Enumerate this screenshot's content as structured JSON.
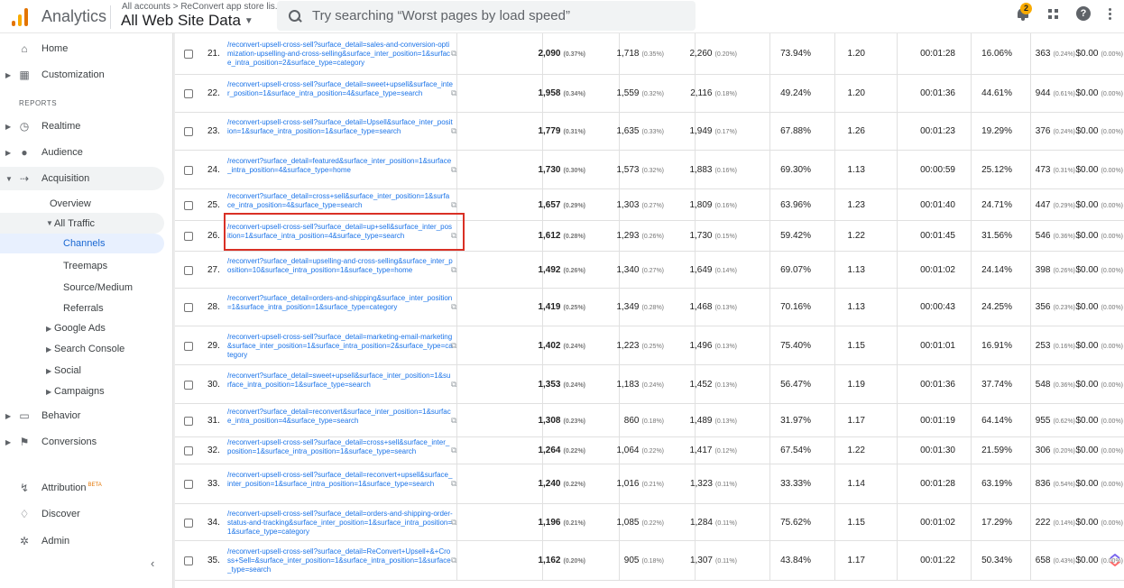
{
  "topbar": {
    "app_title": "Analytics",
    "breadcrumb": "All accounts > ReConvert app store lis...",
    "view_name": "All Web Site Data",
    "search_placeholder": "Try searching “Worst pages by load speed”",
    "notification_count": "2"
  },
  "sidebar": {
    "home": "Home",
    "customization": "Customization",
    "reports_header": "REPORTS",
    "realtime": "Realtime",
    "audience": "Audience",
    "acquisition": "Acquisition",
    "overview": "Overview",
    "all_traffic": "All Traffic",
    "channels": "Channels",
    "treemaps": "Treemaps",
    "source_medium": "Source/Medium",
    "referrals": "Referrals",
    "google_ads": "Google Ads",
    "search_console": "Search Console",
    "social": "Social",
    "campaigns": "Campaigns",
    "behavior": "Behavior",
    "conversions": "Conversions",
    "attribution": "Attribution",
    "attribution_badge": "BETA",
    "discover": "Discover",
    "admin": "Admin"
  },
  "table": {
    "highlighted_row": 26,
    "rows": [
      {
        "n": "21.",
        "page": "/reconvert-upsell-cross-sell?surface_detail=sales-and-conversion-optimization-upselling-and-cross-selling&surface_inter_position=1&surface_intra_position=2&surface_type=category",
        "pv": "2,090",
        "pvp": "(0.37%)",
        "upv": "1,718",
        "upvp": "(0.35%)",
        "ent": "2,260",
        "entp": "(0.20%)",
        "bounce": "73.94%",
        "pps": "1.20",
        "dur": "00:01:28",
        "new": "16.06%",
        "ses": "363",
        "sesp": "(0.24%)",
        "val": "$0.00",
        "valp": "(0.00%)"
      },
      {
        "n": "22.",
        "page": "/reconvert-upsell-cross-sell?surface_detail=sweet+upsell&surface_inter_position=1&surface_intra_position=4&surface_type=search",
        "pv": "1,958",
        "pvp": "(0.34%)",
        "upv": "1,559",
        "upvp": "(0.32%)",
        "ent": "2,116",
        "entp": "(0.18%)",
        "bounce": "49.24%",
        "pps": "1.20",
        "dur": "00:01:36",
        "new": "44.61%",
        "ses": "944",
        "sesp": "(0.61%)",
        "val": "$0.00",
        "valp": "(0.00%)"
      },
      {
        "n": "23.",
        "page": "/reconvert-upsell-cross-sell?surface_detail=Upsell&surface_inter_position=1&surface_intra_position=1&surface_type=search",
        "pv": "1,779",
        "pvp": "(0.31%)",
        "upv": "1,635",
        "upvp": "(0.33%)",
        "ent": "1,949",
        "entp": "(0.17%)",
        "bounce": "67.88%",
        "pps": "1.26",
        "dur": "00:01:23",
        "new": "19.29%",
        "ses": "376",
        "sesp": "(0.24%)",
        "val": "$0.00",
        "valp": "(0.00%)"
      },
      {
        "n": "24.",
        "page": "/reconvert?surface_detail=featured&surface_inter_position=1&surface_intra_position=4&surface_type=home",
        "pv": "1,730",
        "pvp": "(0.30%)",
        "upv": "1,573",
        "upvp": "(0.32%)",
        "ent": "1,883",
        "entp": "(0.16%)",
        "bounce": "69.30%",
        "pps": "1.13",
        "dur": "00:00:59",
        "new": "25.12%",
        "ses": "473",
        "sesp": "(0.31%)",
        "val": "$0.00",
        "valp": "(0.00%)"
      },
      {
        "n": "25.",
        "page": "/reconvert?surface_detail=cross+sell&surface_inter_position=1&surface_intra_position=4&surface_type=search",
        "pv": "1,657",
        "pvp": "(0.29%)",
        "upv": "1,303",
        "upvp": "(0.27%)",
        "ent": "1,809",
        "entp": "(0.16%)",
        "bounce": "63.96%",
        "pps": "1.23",
        "dur": "00:01:40",
        "new": "24.71%",
        "ses": "447",
        "sesp": "(0.29%)",
        "val": "$0.00",
        "valp": "(0.00%)"
      },
      {
        "n": "26.",
        "page": "/reconvert-upsell-cross-sell?surface_detail=up+sell&surface_inter_position=1&surface_intra_position=4&surface_type=search",
        "pv": "1,612",
        "pvp": "(0.28%)",
        "upv": "1,293",
        "upvp": "(0.26%)",
        "ent": "1,730",
        "entp": "(0.15%)",
        "bounce": "59.42%",
        "pps": "1.22",
        "dur": "00:01:45",
        "new": "31.56%",
        "ses": "546",
        "sesp": "(0.36%)",
        "val": "$0.00",
        "valp": "(0.00%)"
      },
      {
        "n": "27.",
        "page": "/reconvert?surface_detail=upselling-and-cross-selling&surface_inter_position=10&surface_intra_position=1&surface_type=home",
        "pv": "1,492",
        "pvp": "(0.26%)",
        "upv": "1,340",
        "upvp": "(0.27%)",
        "ent": "1,649",
        "entp": "(0.14%)",
        "bounce": "69.07%",
        "pps": "1.13",
        "dur": "00:01:02",
        "new": "24.14%",
        "ses": "398",
        "sesp": "(0.26%)",
        "val": "$0.00",
        "valp": "(0.00%)"
      },
      {
        "n": "28.",
        "page": "/reconvert?surface_detail=orders-and-shipping&surface_inter_position=1&surface_intra_position=1&surface_type=category",
        "pv": "1,419",
        "pvp": "(0.25%)",
        "upv": "1,349",
        "upvp": "(0.28%)",
        "ent": "1,468",
        "entp": "(0.13%)",
        "bounce": "70.16%",
        "pps": "1.13",
        "dur": "00:00:43",
        "new": "24.25%",
        "ses": "356",
        "sesp": "(0.23%)",
        "val": "$0.00",
        "valp": "(0.00%)"
      },
      {
        "n": "29.",
        "page": "/reconvert-upsell-cross-sell?surface_detail=marketing-email-marketing&surface_inter_position=1&surface_intra_position=2&surface_type=category",
        "pv": "1,402",
        "pvp": "(0.24%)",
        "upv": "1,223",
        "upvp": "(0.25%)",
        "ent": "1,496",
        "entp": "(0.13%)",
        "bounce": "75.40%",
        "pps": "1.15",
        "dur": "00:01:01",
        "new": "16.91%",
        "ses": "253",
        "sesp": "(0.16%)",
        "val": "$0.00",
        "valp": "(0.00%)"
      },
      {
        "n": "30.",
        "page": "/reconvert?surface_detail=sweet+upsell&surface_inter_position=1&surface_intra_position=1&surface_type=search",
        "pv": "1,353",
        "pvp": "(0.24%)",
        "upv": "1,183",
        "upvp": "(0.24%)",
        "ent": "1,452",
        "entp": "(0.13%)",
        "bounce": "56.47%",
        "pps": "1.19",
        "dur": "00:01:36",
        "new": "37.74%",
        "ses": "548",
        "sesp": "(0.36%)",
        "val": "$0.00",
        "valp": "(0.00%)"
      },
      {
        "n": "31.",
        "page": "/reconvert?surface_detail=reconvert&surface_inter_position=1&surface_intra_position=4&surface_type=search",
        "pv": "1,308",
        "pvp": "(0.23%)",
        "upv": "860",
        "upvp": "(0.18%)",
        "ent": "1,489",
        "entp": "(0.13%)",
        "bounce": "31.97%",
        "pps": "1.17",
        "dur": "00:01:19",
        "new": "64.14%",
        "ses": "955",
        "sesp": "(0.62%)",
        "val": "$0.00",
        "valp": "(0.00%)"
      },
      {
        "n": "32.",
        "page": "/reconvert-upsell-cross-sell?surface_detail=cross+sell&surface_inter_position=1&surface_intra_position=1&surface_type=search",
        "pv": "1,264",
        "pvp": "(0.22%)",
        "upv": "1,064",
        "upvp": "(0.22%)",
        "ent": "1,417",
        "entp": "(0.12%)",
        "bounce": "67.54%",
        "pps": "1.22",
        "dur": "00:01:30",
        "new": "21.59%",
        "ses": "306",
        "sesp": "(0.20%)",
        "val": "$0.00",
        "valp": "(0.00%)"
      },
      {
        "n": "33.",
        "page": "/reconvert-upsell-cross-sell?surface_detail=reconvert+upsell&surface_inter_position=1&surface_intra_position=1&surface_type=search",
        "pv": "1,240",
        "pvp": "(0.22%)",
        "upv": "1,016",
        "upvp": "(0.21%)",
        "ent": "1,323",
        "entp": "(0.11%)",
        "bounce": "33.33%",
        "pps": "1.14",
        "dur": "00:01:28",
        "new": "63.19%",
        "ses": "836",
        "sesp": "(0.54%)",
        "val": "$0.00",
        "valp": "(0.00%)"
      },
      {
        "n": "34.",
        "page": "/reconvert-upsell-cross-sell?surface_detail=orders-and-shipping-order-status-and-tracking&surface_inter_position=1&surface_intra_position=1&surface_type=category",
        "pv": "1,196",
        "pvp": "(0.21%)",
        "upv": "1,085",
        "upvp": "(0.22%)",
        "ent": "1,284",
        "entp": "(0.11%)",
        "bounce": "75.62%",
        "pps": "1.15",
        "dur": "00:01:02",
        "new": "17.29%",
        "ses": "222",
        "sesp": "(0.14%)",
        "val": "$0.00",
        "valp": "(0.00%)"
      },
      {
        "n": "35.",
        "page": "/reconvert-upsell-cross-sell?surface_detail=ReConvert+Upsell+&+Cross+Sell=&surface_inter_position=1&surface_intra_position=1&surface_type=search",
        "pv": "1,162",
        "pvp": "(0.20%)",
        "upv": "905",
        "upvp": "(0.18%)",
        "ent": "1,307",
        "entp": "(0.11%)",
        "bounce": "43.84%",
        "pps": "1.17",
        "dur": "00:01:22",
        "new": "50.34%",
        "ses": "658",
        "sesp": "(0.43%)",
        "val": "$0.00",
        "valp": "(0.00%)"
      }
    ]
  }
}
